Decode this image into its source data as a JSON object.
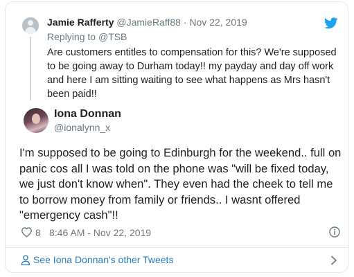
{
  "parent_tweet": {
    "author_name": "Jamie Rafferty",
    "handle": "@JamieRaff88",
    "separator": "·",
    "date": "Nov 22, 2019",
    "replying_prefix": "Replying to",
    "replying_to": "@TSB",
    "text": "Are customers entitles to compensation for this? We're supposed to be going away to Durham today!! my payday and day off work and here I am sitting waiting to see what happens as Mrs hasn't been paid!!"
  },
  "main_tweet": {
    "author_name": "Iona Donnan",
    "handle": "@ionalynn_x",
    "text": "I'm supposed to be going to Edinburgh for the weekend.. full on panic cos all I was told on the phone was \"will be fixed today, we just don't know when\". They even had the cheek to tell me to borrow money from family or friends.. I wasnt offered \"emergency cash\"!!",
    "like_count": "8",
    "timestamp": "8:46 AM - Nov 22, 2019"
  },
  "footer": {
    "see_other_label": "See Iona Donnan's other Tweets"
  },
  "icons": {
    "brand": "twitter-bird-icon",
    "like": "heart-icon",
    "info": "info-icon",
    "profile": "person-icon",
    "more": "chevron-right-icon"
  },
  "colors": {
    "twitter_blue": "#1da1f2",
    "link_blue": "#2b7bb9",
    "secondary_text": "#697882",
    "border": "#e1e8ed"
  }
}
